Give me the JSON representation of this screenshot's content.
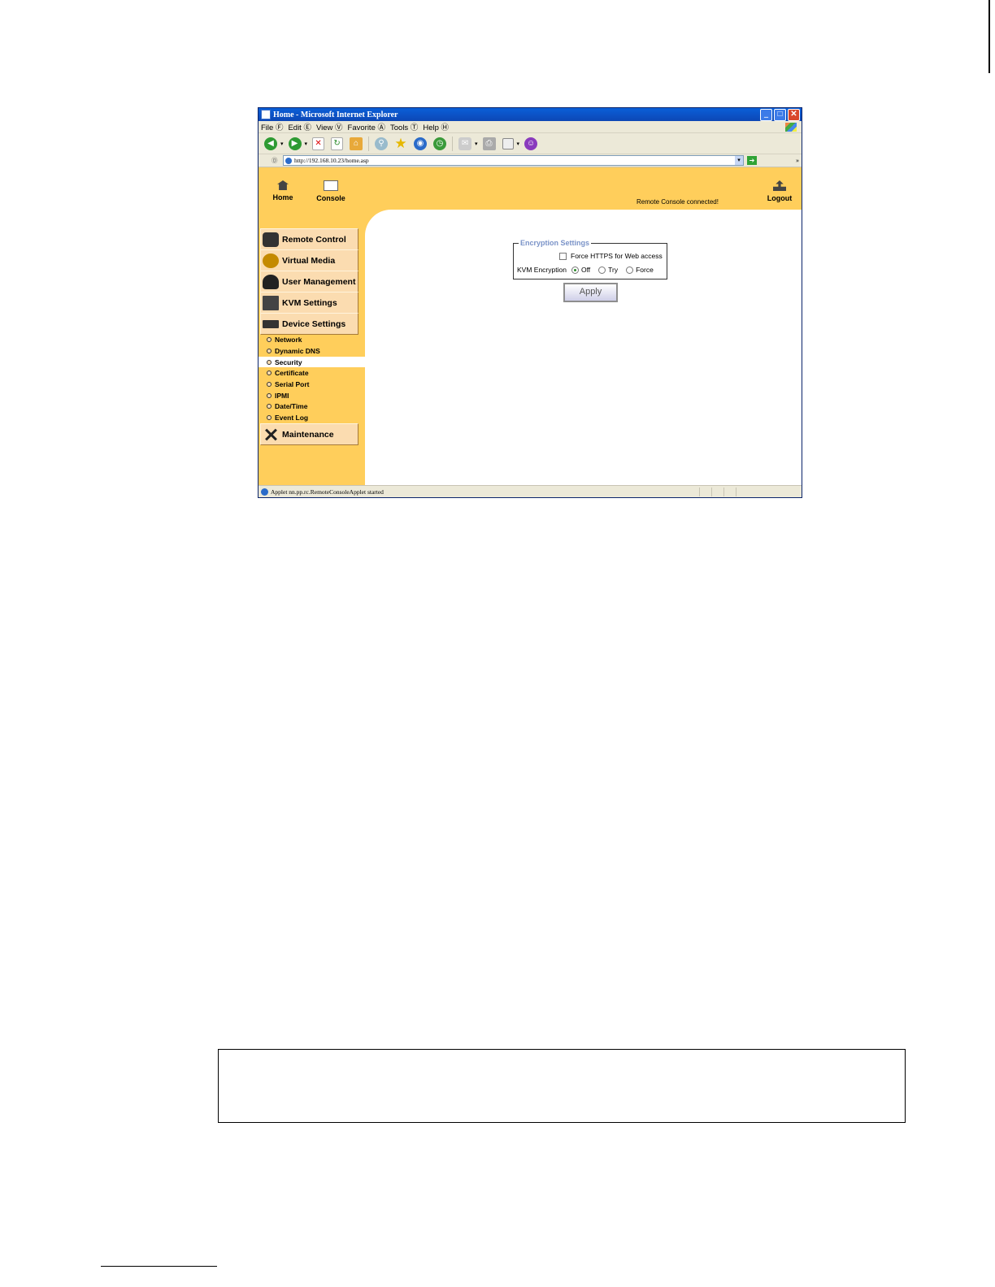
{
  "window": {
    "title": "Home - Microsoft Internet Explorer",
    "controls": {
      "minimize": "_",
      "maximize": "□",
      "close": "✕"
    }
  },
  "menubar": [
    "File Ⓕ",
    "Edit Ⓔ",
    "View Ⓥ",
    "Favorite Ⓐ",
    "Tools Ⓣ",
    "Help Ⓗ"
  ],
  "toolbar": {
    "icons": [
      "back-icon",
      "forward-icon",
      "stop-icon",
      "refresh-icon",
      "home-icon",
      "search-icon",
      "favorites-icon",
      "media-icon",
      "history-icon",
      "mail-icon",
      "print-icon",
      "edit-icon",
      "messenger-icon"
    ]
  },
  "address": {
    "label": "Ⓓ",
    "url": "http://192.168.10.23/home.asp"
  },
  "topnav": {
    "home": "Home",
    "console": "Console",
    "status": "Remote Console connected!",
    "logout": "Logout"
  },
  "sidebar": {
    "buttons": [
      "Remote Control",
      "Virtual Media",
      "User Management",
      "KVM Settings",
      "Device Settings"
    ],
    "subitems": [
      "Network",
      "Dynamic DNS",
      "Security",
      "Certificate",
      "Serial Port",
      "IPMI",
      "Date/Time",
      "Event Log"
    ],
    "active_subitem": "Security",
    "maintenance": "Maintenance"
  },
  "encryption": {
    "legend": "Encryption Settings",
    "force_https_label": "Force HTTPS for Web access",
    "force_https_checked": false,
    "kvm_label": "KVM Encryption",
    "options": [
      "Off",
      "Try",
      "Force"
    ],
    "selected": "Off"
  },
  "apply_label": "Apply",
  "statusbar": {
    "text": "Applet nn.pp.rc.RemoteConsoleApplet started"
  }
}
